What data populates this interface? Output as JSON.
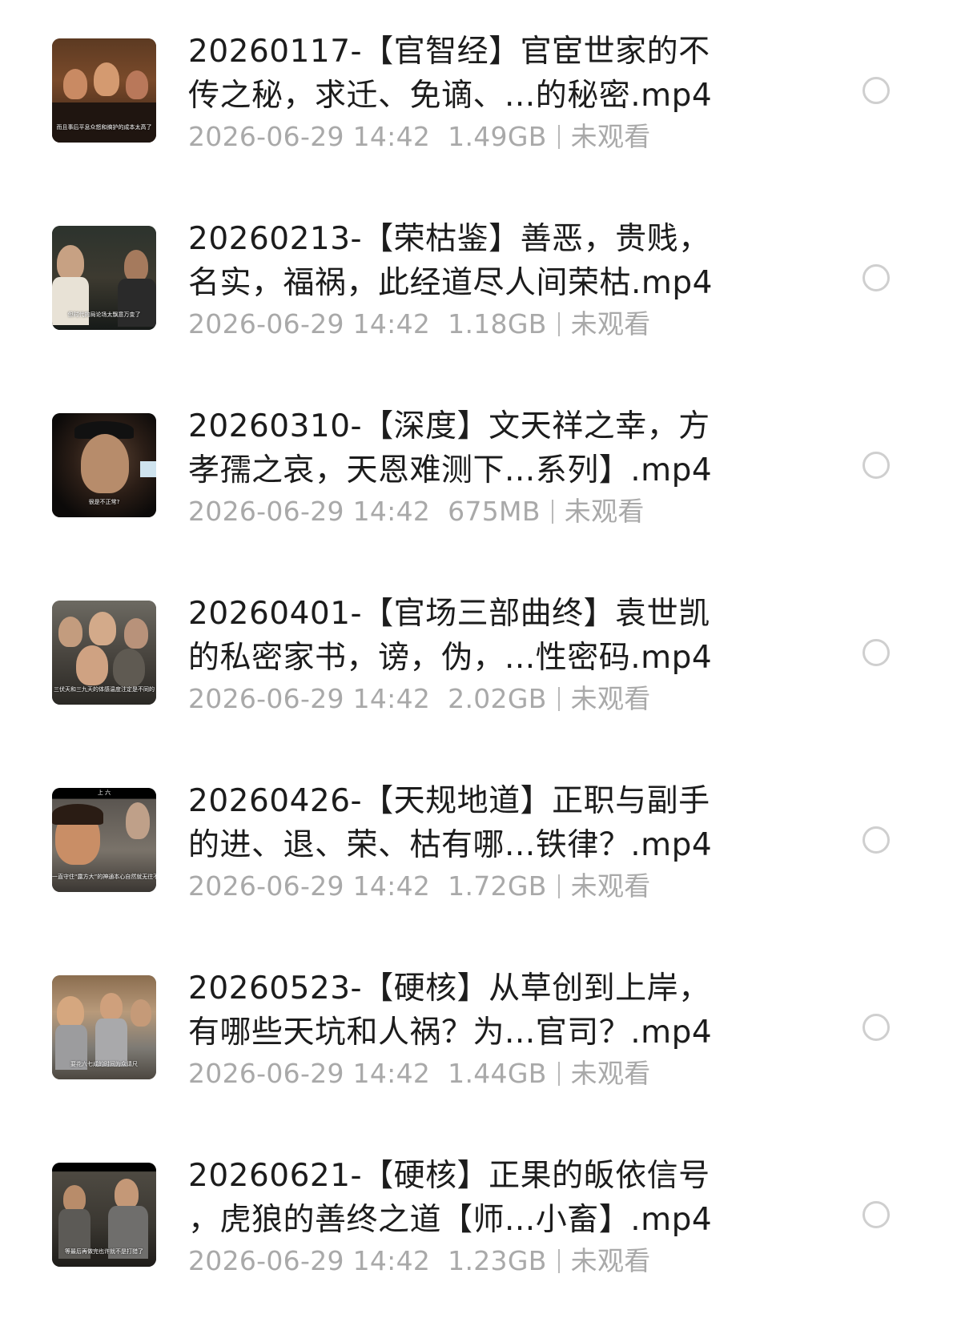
{
  "files": [
    {
      "title_line1": "20260117-【官智经】官宦世家的不",
      "title_line2": "传之秘，求迁、免谪、...的秘密.mp4",
      "date": "2026-06-29 14:42",
      "size": "1.49GB",
      "status": "未观看",
      "thumb_caption": "而且事后平息众怒和搞护的成本太高了"
    },
    {
      "title_line1": "20260213-【荣枯鉴】善恶，贵贱，",
      "title_line2": "名实，福祸，此经道尽人间荣枯.mp4",
      "date": "2026-06-29 14:42",
      "size": "1.18GB",
      "status": "未观看",
      "thumb_caption": "但时代的局论场太飘意万变了"
    },
    {
      "title_line1": "20260310-【深度】文天祥之幸，方",
      "title_line2": "孝孺之哀，天恩难测下...系列】.mp4",
      "date": "2026-06-29 14:42",
      "size": "675MB",
      "status": "未观看",
      "thumb_caption": "很是不正常?"
    },
    {
      "title_line1": "20260401-【官场三部曲终】袁世凯",
      "title_line2": "的私密家书，谤，伪，...性密码.mp4",
      "date": "2026-06-29 14:42",
      "size": "2.02GB",
      "status": "未观看",
      "thumb_caption": "三伏天和三九天的体感温度注定是不同的"
    },
    {
      "title_line1": "20260426-【天规地道】正职与副手",
      "title_line2": "的进、退、荣、枯有哪...铁律？.mp4",
      "date": "2026-06-29 14:42",
      "size": "1.72GB",
      "status": "未观看",
      "thumb_caption": "一直守住“露方大”的神通本心自然就无往不",
      "thumb_top_label": "上 六"
    },
    {
      "title_line1": "20260523-【硬核】从草创到上岸，",
      "title_line2": "有哪些天坑和人祸？为...官司？.mp4",
      "date": "2026-06-29 14:42",
      "size": "1.44GB",
      "status": "未观看",
      "thumb_caption": "要花六七成的时间为众请尺"
    },
    {
      "title_line1": "20260621-【硬核】正果的皈依信号",
      "title_line2": "，虎狼的善终之道【师...小畜】.mp4",
      "date": "2026-06-29 14:42",
      "size": "1.23GB",
      "status": "未观看",
      "thumb_caption": "等最后再做完也许就不是打猎了"
    }
  ],
  "icons": {
    "select": "radio-circle-icon"
  },
  "colors": {
    "title": "#1c1c1c",
    "meta": "#a9a9a9",
    "radio_border": "#cfcfcf",
    "background": "#ffffff"
  }
}
